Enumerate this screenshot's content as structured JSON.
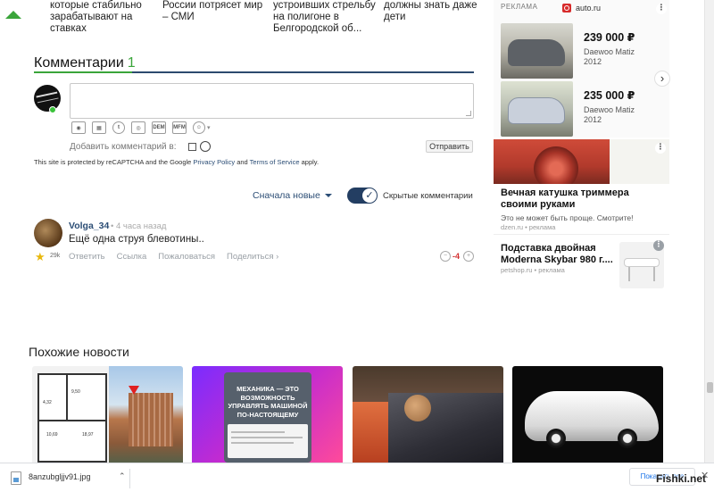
{
  "top_news": [
    {
      "text": "которые стабильно зарабатывают на ставках"
    },
    {
      "text": "России потрясет мир – СМИ"
    },
    {
      "text": "устроивших стрельбу на полигоне в Белгородской об..."
    },
    {
      "text": "должны знать даже дети"
    }
  ],
  "comments": {
    "title": "Комментарии",
    "count": "1",
    "add_to_label": "Добавить комментарий в:",
    "send_label": "Отправить",
    "recaptcha": {
      "prefix": "This site is protected by reCAPTCHA and the Google ",
      "privacy": "Privacy Policy",
      "and": " and ",
      "terms": "Terms of Service",
      "suffix": " apply."
    },
    "toolbar_icons": [
      "camera-icon",
      "film-icon",
      "twitter-icon",
      "instagram-icon",
      "dem-icon",
      "mfm-icon",
      "smiley-icon"
    ],
    "tool_dem": "DEM",
    "tool_mfm": "MFM",
    "sort_label": "Сначала новые",
    "hidden_label": "Скрытые комментарии",
    "hidden_enabled": true
  },
  "comment": {
    "author": "Volga_34",
    "time": "• 4 часа назад",
    "text": "Ещё одна струя блевотины..",
    "rating": "29k",
    "actions": [
      "Ответить",
      "Ссылка",
      "Пожаловаться",
      "Поделиться ›"
    ],
    "score": "-4"
  },
  "similar": {
    "title": "Похожие новости",
    "card2_text": "Механика — это возможность управлять машиной по-настоящему",
    "plan_labels": [
      "4,32",
      "9,50",
      "10,69",
      "18,97"
    ]
  },
  "ads": {
    "label": "РЕКЛАМА",
    "brand": "auto.ru",
    "cars": [
      {
        "price": "239 000 ₽",
        "model": "Daewoo Matiz 2012"
      },
      {
        "price": "235 000 ₽",
        "model": "Daewoo Matiz 2012"
      }
    ],
    "ad2": {
      "title": "Вечная катушка триммера своими руками",
      "desc": "Это не может быть проще. Смотрите!",
      "source": "dzen.ru • реклама"
    },
    "ad3": {
      "title": "Подставка двойная Moderna Skybar 980 г....",
      "source": "petshop.ru • реклама"
    },
    "dots": "⋮",
    "next": "›"
  },
  "download": {
    "filename": "8anzubgljjv91.jpg",
    "show_all": "Показать все",
    "close": "✕"
  },
  "watermark": "Fishki.net"
}
